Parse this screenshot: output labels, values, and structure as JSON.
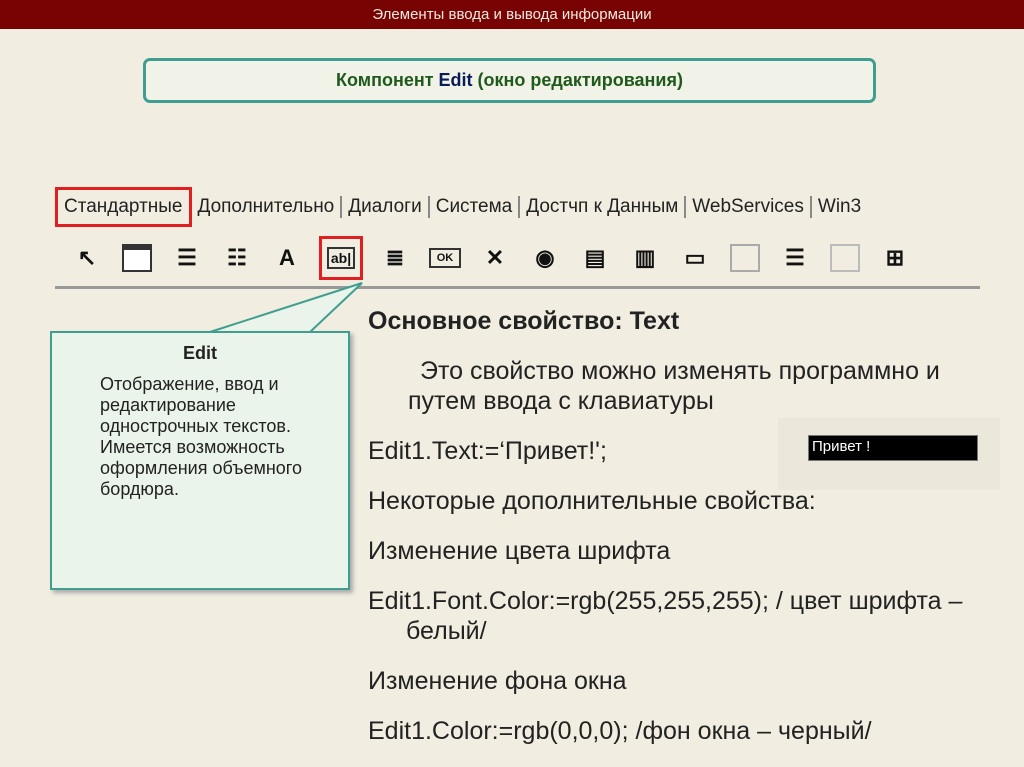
{
  "header": {
    "title": "Элементы ввода и вывода информации"
  },
  "slide_title": {
    "prefix": "Компонент ",
    "name": "Edit",
    "suffix": " (окно редактирования)"
  },
  "palette": {
    "tabs": [
      "Стандартные",
      "Дополнительно",
      "Диалоги",
      "Система",
      "Достчп к Данным",
      "WebServices",
      "Win3"
    ],
    "tools": [
      "pointer-icon",
      "frame-icon",
      "main-menu-icon",
      "popup-menu-icon",
      "label-icon",
      "edit-icon",
      "memo-icon",
      "button-icon",
      "checkbox-icon",
      "radio-icon",
      "listbox-icon",
      "combobox-icon",
      "scrollbar-icon",
      "groupbox-icon",
      "radiogroup-icon",
      "panel-icon",
      "actionlist-icon"
    ],
    "label_glyph": "A",
    "edit_glyph": "ab|",
    "button_glyph": "OK",
    "checkbox_glyph": "✕",
    "radio_glyph": "◉"
  },
  "callout": {
    "title": "Edit",
    "text": "Отображение, ввод и редактирование однострочных текстов. Имеется возможность оформления объемного бордюра."
  },
  "main": {
    "heading": "Основное свойство: Text",
    "p1": "Это свойство можно изменять программно и путем ввода с клавиатуры",
    "p2": "Edit1.Text:=‘Привет!';",
    "p3": "Некоторые дополнительные свойства:",
    "p4": "Изменение цвета шрифта",
    "p5": "Edit1.Font.Color:=rgb(255,255,255); / цвет шрифта – белый/",
    "p6": "Изменение фона окна",
    "p7": "Edit1.Color:=rgb(0,0,0); /фон окна – черный/"
  },
  "sample": {
    "value": "Привет !"
  }
}
